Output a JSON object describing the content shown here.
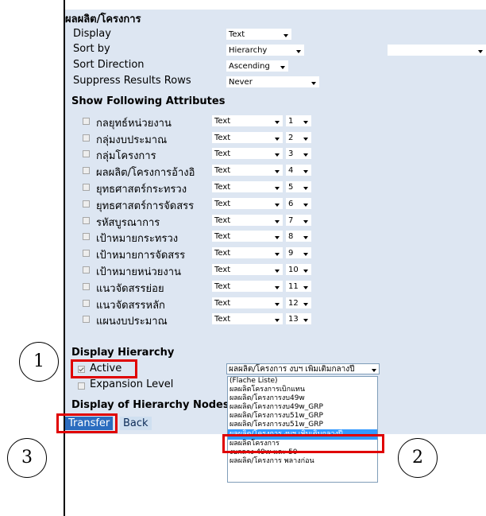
{
  "header": {
    "title": "ผลผลิต/โครงการ"
  },
  "settings": {
    "display_label": "Display",
    "display_value": "Text",
    "sortby_label": "Sort by",
    "sortby_value": "Hierarchy",
    "sortby_extra_value": "",
    "sortdir_label": "Sort Direction",
    "sortdir_value": "Ascending",
    "suppress_label": "Suppress Results Rows",
    "suppress_value": "Never"
  },
  "attributes_heading": "Show Following Attributes",
  "attributes": [
    {
      "label": "กลยุทธ์หน่วยงาน",
      "display": "Text",
      "order": "1"
    },
    {
      "label": "กลุ่มงบประมาณ",
      "display": "Text",
      "order": "2"
    },
    {
      "label": "กลุ่มโครงการ",
      "display": "Text",
      "order": "3"
    },
    {
      "label": "ผลผลิต/โครงการอ้างอิ",
      "display": "Text",
      "order": "4"
    },
    {
      "label": "ยุทธศาสตร์กระทรวง",
      "display": "Text",
      "order": "5"
    },
    {
      "label": "ยุทธศาสตร์การจัดสรร",
      "display": "Text",
      "order": "6"
    },
    {
      "label": "รหัสบูรณาการ",
      "display": "Text",
      "order": "7"
    },
    {
      "label": "เป้าหมายกระทรวง",
      "display": "Text",
      "order": "8"
    },
    {
      "label": "เป้าหมายการจัดสรร",
      "display": "Text",
      "order": "9"
    },
    {
      "label": "เป้าหมายหน่วยงาน",
      "display": "Text",
      "order": "10"
    },
    {
      "label": "แนวจัดสรรย่อย",
      "display": "Text",
      "order": "11"
    },
    {
      "label": "แนวจัดสรรหลัก",
      "display": "Text",
      "order": "12"
    },
    {
      "label": "แผนงบประมาณ",
      "display": "Text",
      "order": "13"
    }
  ],
  "hierarchy": {
    "heading": "Display Hierarchy",
    "active_label": "Active",
    "expansion_label": "Expansion Level",
    "selected_value": "ผลผลิต/โครงการ งบฯ เพิ่มเติมกลางปี",
    "options": [
      "(Flache Liste)",
      "ผลผลิตโครงการเบิกแทน",
      "ผลผลิต/โครงการงบ49w",
      "ผลผลิต/โครงการงบ49w_GRP",
      "ผลผลิต/โครงการงบ51w_GRP",
      "ผลผลิต/โครงการงบ51w_GRP",
      "ผลผลิต/โครงการ งบฯ เพิ่มเติมกลางปี",
      "ผลผลิตโครงการ",
      "งบกลาง 49w และ 50",
      "ผลผลิต/โครงการ พลางก่อน"
    ]
  },
  "nodes_heading": "Display of Hierarchy Nodes",
  "buttons": {
    "transfer": "Transfer",
    "back": "Back"
  },
  "callouts": [
    "1",
    "2",
    "3"
  ],
  "colors": {
    "highlight_red": "#e00000",
    "panel_bg": "#dde6f2",
    "selected_option": "#3399ff"
  }
}
